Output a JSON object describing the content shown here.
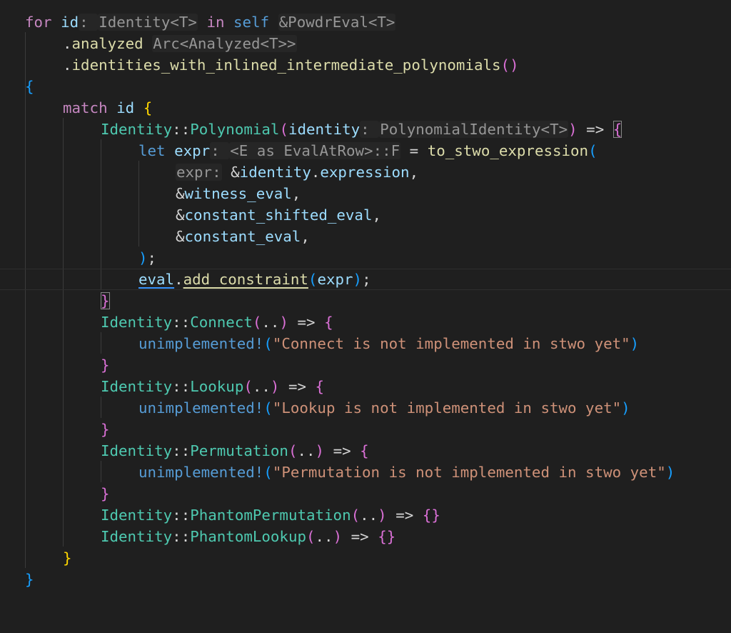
{
  "editor": {
    "language": "rust",
    "colors": {
      "background": "#1f1f1f",
      "keyword": "#c586c0",
      "variable": "#9cdcfe",
      "function": "#dcdcaa",
      "type": "#4ec9b0",
      "string": "#ce9178",
      "inlay_hint": "#969696"
    },
    "lines": [
      [
        "for",
        " ",
        "id",
        ": ",
        "Identity<T>",
        " ",
        "in",
        " ",
        "self",
        " ",
        "&PowdrEval<T>"
      ],
      [
        ".",
        "analyzed",
        " ",
        "Arc<Analyzed<T>>"
      ],
      [
        ".",
        "identities_with_inlined_intermediate_polynomials",
        "(",
        ")"
      ],
      [
        "{"
      ],
      [
        "match",
        " ",
        "id",
        " ",
        "{"
      ],
      [
        "Identity",
        "::",
        "Polynomial",
        "(",
        "identity",
        ": ",
        "PolynomialIdentity<T>",
        ")",
        " => ",
        "{"
      ],
      [
        "let",
        " ",
        "expr",
        ": ",
        "<E as EvalAtRow>::F",
        " = ",
        "to_stwo_expression",
        "("
      ],
      [
        "expr:",
        " ",
        "&",
        "identity",
        ".",
        "expression",
        ","
      ],
      [
        "&",
        "witness_eval",
        ","
      ],
      [
        "&",
        "constant_shifted_eval",
        ","
      ],
      [
        "&",
        "constant_eval",
        ","
      ],
      [
        ")",
        ";"
      ],
      [
        "eval",
        ".",
        "add_constraint",
        "(",
        "expr",
        ")",
        ";"
      ],
      [
        "}"
      ],
      [
        "Identity",
        "::",
        "Connect",
        "(",
        "..",
        ")",
        " => ",
        "{"
      ],
      [
        "unimplemented!",
        "(",
        "\"Connect is not implemented in stwo yet\"",
        ")"
      ],
      [
        "}"
      ],
      [
        "Identity",
        "::",
        "Lookup",
        "(",
        "..",
        ")",
        " => ",
        "{"
      ],
      [
        "unimplemented!",
        "(",
        "\"Lookup is not implemented in stwo yet\"",
        ")"
      ],
      [
        "}"
      ],
      [
        "Identity",
        "::",
        "Permutation",
        "(",
        "..",
        ")",
        " => ",
        "{"
      ],
      [
        "unimplemented!",
        "(",
        "\"Permutation is not implemented in stwo yet\"",
        ")"
      ],
      [
        "}"
      ],
      [
        "Identity",
        "::",
        "PhantomPermutation",
        "(",
        "..",
        ")",
        " => ",
        "{}"
      ],
      [
        "Identity",
        "::",
        "PhantomLookup",
        "(",
        "..",
        ")",
        " => ",
        "{}"
      ],
      [
        "}"
      ],
      [
        "}"
      ]
    ]
  }
}
